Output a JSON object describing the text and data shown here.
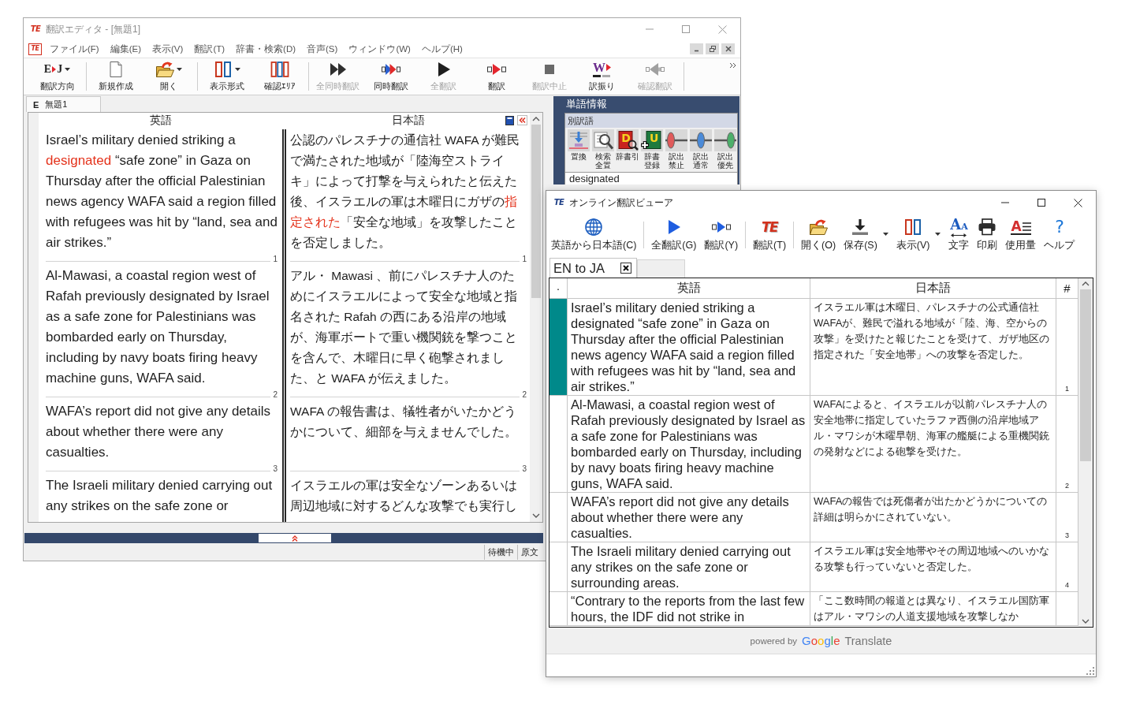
{
  "editor": {
    "title": "翻訳エディタ - [無題1]",
    "icon_glyph": "TE",
    "menu_icon_glyph": "TE",
    "menu": [
      "ファイル(F)",
      "編集(E)",
      "表示(V)",
      "翻訳(T)",
      "辞書・検索(D)",
      "音声(S)",
      "ウィンドウ(W)",
      "ヘルプ(H)"
    ],
    "toolbar_groups": [
      {
        "items": [
          {
            "kind": "direction",
            "label": "翻訳方向",
            "glyphs": [
              "E",
              "J"
            ],
            "dropdown": true,
            "disabled": false
          }
        ]
      },
      {
        "items": [
          {
            "kind": "new",
            "label": "新規作成",
            "dropdown": false,
            "disabled": false
          },
          {
            "kind": "open",
            "label": "開く",
            "dropdown": true,
            "disabled": false
          }
        ]
      },
      {
        "items": [
          {
            "kind": "layout",
            "label": "表示形式",
            "dropdown": true,
            "disabled": false
          },
          {
            "kind": "confirm-area",
            "label": "確認ｴﾘｱ",
            "dropdown": false,
            "disabled": false
          }
        ]
      },
      {
        "items": [
          {
            "kind": "all-sync",
            "label": "全同時翻訳",
            "dropdown": false,
            "disabled": true
          },
          {
            "kind": "sync",
            "label": "同時翻訳",
            "dropdown": false,
            "disabled": false
          },
          {
            "kind": "all",
            "label": "全翻訳",
            "dropdown": false,
            "disabled": true
          },
          {
            "kind": "translate",
            "label": "翻訳",
            "dropdown": false,
            "disabled": false
          },
          {
            "kind": "stop",
            "label": "翻訳中止",
            "dropdown": false,
            "disabled": true
          },
          {
            "kind": "furigana",
            "label": "訳振り",
            "glyph": "W",
            "dropdown": false,
            "disabled": false
          },
          {
            "kind": "confirm-translate",
            "label": "確認翻訳",
            "dropdown": false,
            "disabled": true
          }
        ]
      }
    ],
    "document_tab": {
      "badge": "E",
      "label": "無題1"
    },
    "columns": [
      "英語",
      "日本語"
    ],
    "segments": [
      {
        "english": [
          {
            "text": "Israel’s military denied striking a ",
            "highlight": false
          },
          {
            "text": "designated",
            "highlight": true
          },
          {
            "text": " “safe zone” in Gaza on Thursday after the official Palestinian news agency WAFA said a region filled with refugees was hit by “land, sea and air strikes.”",
            "highlight": false
          }
        ],
        "english_number": "1",
        "japanese": [
          {
            "text": "公認のパレスチナの通信社 WAFA が難民で満たされた地域が「陸海空ストライキ」によって打撃を与えられたと伝えた後、イスラエルの軍は木曜日にガザの",
            "highlight": false
          },
          {
            "text": "指定された",
            "highlight": true
          },
          {
            "text": "「安全な地域」を攻撃したことを否定しました。",
            "highlight": false
          }
        ],
        "japanese_number": "1"
      },
      {
        "english": [
          {
            "text": "Al-Mawasi, a coastal region west of Rafah previously designated by Israel as a safe zone for Palestinians was bombarded early on Thursday, including by navy boats firing heavy machine guns, WAFA said.",
            "highlight": false
          }
        ],
        "english_number": "2",
        "japanese": [
          {
            "text": "アル・ Mawasi 、前にパレスチナ人のためにイスラエルによって安全な地域と指名された Rafah の西にある沿岸の地域が、海軍ボートで重い機関銃を撃つことを含んで、木曜日に早く砲撃されました、と WAFA が伝えました。",
            "highlight": false
          }
        ],
        "japanese_number": "2"
      },
      {
        "english": [
          {
            "text": "WAFA’s report did not give any details about whether there were any casualties.",
            "highlight": false
          }
        ],
        "english_number": "3",
        "japanese": [
          {
            "text": "WAFA の報告書は、犠牲者がいたかどうかについて、細部を与えませんでした。",
            "highlight": false
          }
        ],
        "japanese_number": "3"
      },
      {
        "english": [
          {
            "text": "The Israeli military denied carrying out any strikes on the safe zone or",
            "highlight": false
          }
        ],
        "japanese": [
          {
            "text": "イスラエルの軍は安全なゾーンあるいは周辺地域に対するどんな攻撃でも実行し",
            "highlight": false
          }
        ]
      }
    ],
    "status": [
      "待機中",
      "原文"
    ]
  },
  "word_panel": {
    "title": "単語情報",
    "section": "別訳語",
    "tools": [
      {
        "kind": "replace",
        "label_lines": [
          "置換"
        ]
      },
      {
        "kind": "search-replace",
        "label_lines": [
          "検索",
          "全置"
        ]
      },
      {
        "kind": "dict-lookup",
        "label_lines": [
          "辞書引"
        ],
        "glyph": "D"
      },
      {
        "kind": "dict-register",
        "label_lines": [
          "辞書",
          "登録"
        ],
        "glyph": "U"
      },
      {
        "kind": "forbid",
        "label_lines": [
          "訳出",
          "禁止"
        ]
      },
      {
        "kind": "normal",
        "label_lines": [
          "訳出",
          "通常"
        ]
      },
      {
        "kind": "prefer",
        "label_lines": [
          "訳出",
          "優先"
        ]
      }
    ],
    "word": "designated"
  },
  "viewer": {
    "title": "オンライン翻訳ビューア",
    "icon_glyph": "TE",
    "toolbar_groups": [
      {
        "items": [
          {
            "kind": "globe",
            "label": "英語から日本語(C)",
            "dropdown": false
          }
        ]
      },
      {
        "items": [
          {
            "kind": "play",
            "label": "全翻訳(G)",
            "dropdown": false
          },
          {
            "kind": "translate",
            "label": "翻訳(Y)",
            "dropdown": false
          }
        ]
      },
      {
        "items": [
          {
            "kind": "te",
            "label": "翻訳(T)",
            "glyph": "TE",
            "dropdown": false
          }
        ]
      },
      {
        "items": [
          {
            "kind": "open",
            "label": "開く(O)",
            "dropdown": false
          },
          {
            "kind": "save",
            "label": "保存(S)",
            "dropdown": true
          },
          {
            "kind": "layout",
            "label": "表示(V)",
            "dropdown": true
          },
          {
            "kind": "font",
            "label": "文字",
            "glyph": "AA",
            "dropdown": false
          },
          {
            "kind": "print",
            "label": "印刷",
            "dropdown": false
          },
          {
            "kind": "usage",
            "label": "使用量",
            "glyph": "A",
            "dropdown": false
          },
          {
            "kind": "help",
            "label": "ヘルプ",
            "glyph": "?",
            "dropdown": false
          }
        ]
      }
    ],
    "tab": "EN to JA",
    "columns": [
      "·",
      "英語",
      "日本語",
      "#"
    ],
    "rows": [
      {
        "selected": true,
        "english": "Israel’s military denied striking a designated “safe zone” in Gaza on Thursday after the official Palestinian news agency WAFA said a region filled with refugees was hit by “land, sea and air strikes.”",
        "japanese": "イスラエル軍は木曜日、パレスチナの公式通信社WAFAが、難民で溢れる地域が「陸、海、空からの攻撃」を受けたと報じたことを受けて、ガザ地区の指定された「安全地帯」への攻撃を否定した。",
        "number": "1"
      },
      {
        "selected": false,
        "english": "Al-Mawasi, a coastal region west of Rafah previously designated by Israel as a safe zone for Palestinians was bombarded early on Thursday, including by navy boats firing heavy machine guns, WAFA said.",
        "japanese": "WAFAによると、イスラエルが以前パレスチナ人の安全地帯に指定していたラファ西側の沿岸地域アル・マワシが木曜早朝、海軍の艦艇による重機関銃の発射などによる砲撃を受けた。",
        "number": "2"
      },
      {
        "selected": false,
        "english": "WAFA’s report did not give any details about whether there were any casualties.",
        "japanese": "WAFAの報告では死傷者が出たかどうかについての詳細は明らかにされていない。",
        "number": "3"
      },
      {
        "selected": false,
        "english": "The Israeli military denied carrying out any strikes on the safe zone or surrounding areas.",
        "japanese": "イスラエル軍は安全地帯やその周辺地域へのいかなる攻撃も行っていないと否定した。",
        "number": "4"
      },
      {
        "selected": false,
        "english": "“Contrary to the reports from the last few hours, the IDF did not strike in",
        "japanese": "「ここ数時間の報道とは異なり、イスラエル国防軍はアル・マワシの人道支援地域を攻撃しなか"
      }
    ],
    "footer": {
      "prefix": "powered by",
      "brand": "Google",
      "service": "Translate"
    }
  }
}
